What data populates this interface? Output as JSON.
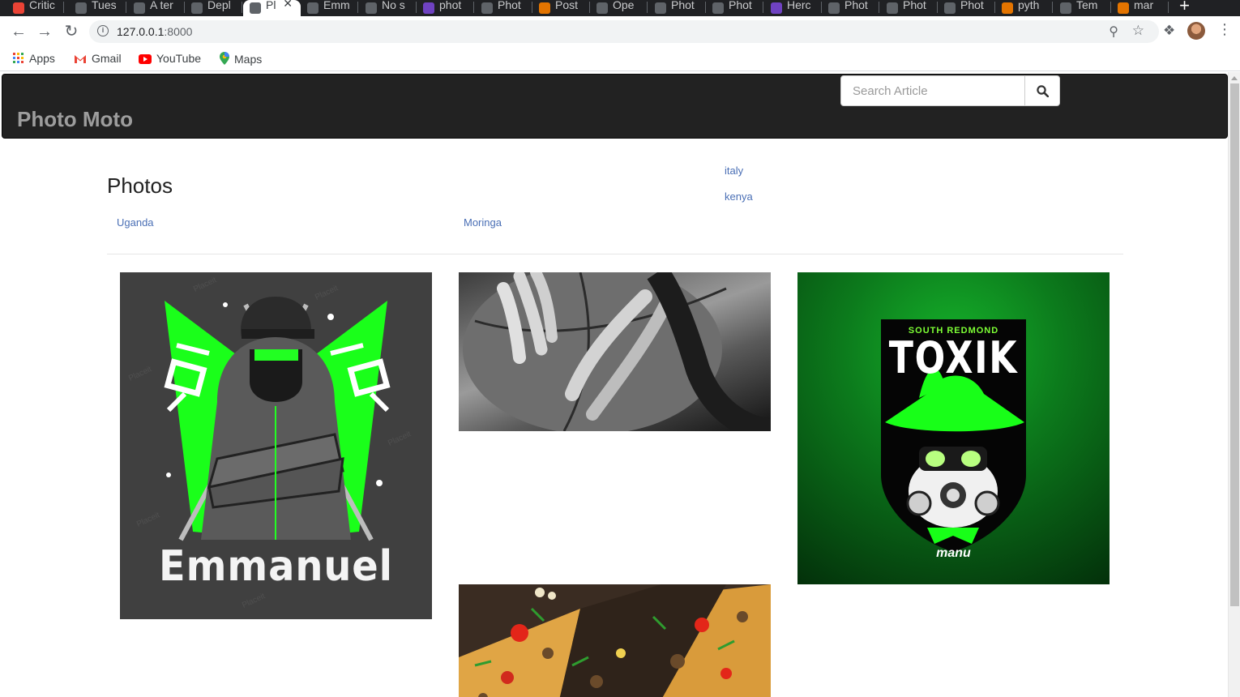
{
  "browser": {
    "tabs": [
      {
        "label": "Critic",
        "fav": "#ea4335"
      },
      {
        "label": "Tues",
        "fav": "#5f6368"
      },
      {
        "label": "A ter",
        "fav": "#5f6368"
      },
      {
        "label": "Depl",
        "fav": "#5f6368"
      },
      {
        "label": "Pl",
        "fav": "#5f6368",
        "active": true
      },
      {
        "label": "Emm",
        "fav": "#5f6368"
      },
      {
        "label": "No s",
        "fav": "#5f6368"
      },
      {
        "label": "phot",
        "fav": "#6f42c1"
      },
      {
        "label": "Phot",
        "fav": "#5f6368"
      },
      {
        "label": "Post",
        "fav": "#e37400"
      },
      {
        "label": "Ope",
        "fav": "#5f6368"
      },
      {
        "label": "Phot",
        "fav": "#5f6368"
      },
      {
        "label": "Phot",
        "fav": "#5f6368"
      },
      {
        "label": "Herc",
        "fav": "#6f42c1"
      },
      {
        "label": "Phot",
        "fav": "#5f6368"
      },
      {
        "label": "Phot",
        "fav": "#5f6368"
      },
      {
        "label": "Phot",
        "fav": "#5f6368"
      },
      {
        "label": "pyth",
        "fav": "#e37400"
      },
      {
        "label": "Tem",
        "fav": "#5f6368"
      },
      {
        "label": "mar",
        "fav": "#e37400"
      }
    ],
    "url_host": "127.0.0.1",
    "url_port": ":8000",
    "bookmarks": [
      {
        "label": "Apps",
        "icon": "apps-grid-icon"
      },
      {
        "label": "Gmail",
        "icon": "gmail-icon"
      },
      {
        "label": "YouTube",
        "icon": "youtube-icon"
      },
      {
        "label": "Maps",
        "icon": "maps-icon"
      }
    ]
  },
  "site": {
    "brand": "Photo Moto",
    "search_placeholder": "Search Article",
    "heading": "Photos",
    "locations": [
      "italy",
      "kenya"
    ],
    "categories": [
      "Uganda",
      "Moringa"
    ]
  },
  "photos": {
    "emmanuel_caption": "Emmanuel",
    "toxik_subtitle": "SOUTH REDMOND",
    "toxik_title": "TOXIK",
    "toxik_sign": "manu",
    "watermark": "Placeit"
  }
}
